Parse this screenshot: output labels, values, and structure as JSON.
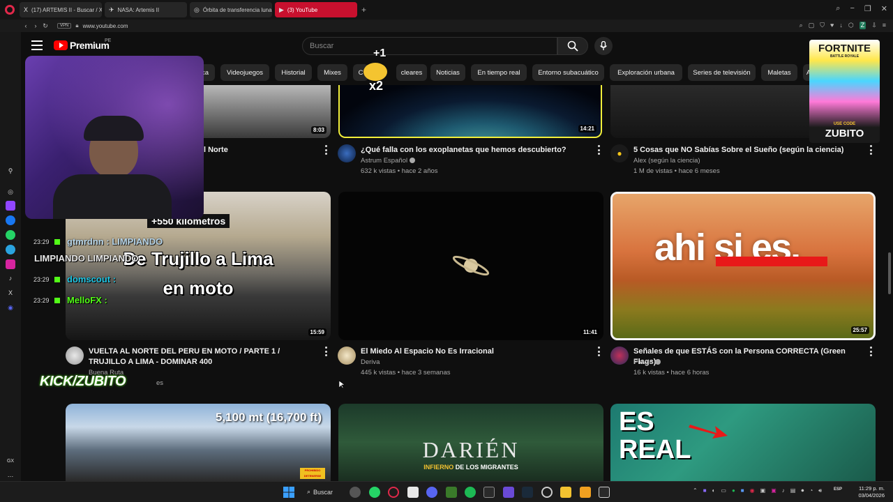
{
  "browser": {
    "tabs": [
      {
        "icon": "X",
        "label": "(17) ARTEMIS II - Buscar / X"
      },
      {
        "icon": "✈",
        "label": "NASA: Artemis II"
      },
      {
        "icon": "◎",
        "label": "Órbita de transferencia lunar"
      },
      {
        "icon": "▶",
        "label": "(3) YouTube"
      }
    ],
    "vpn_label": "VPN",
    "url": "www.youtube.com"
  },
  "youtube": {
    "brand": "Premium",
    "country": "PE",
    "search_placeholder": "Buscar",
    "chips": [
      "ca",
      "Videojuegos",
      "Historial",
      "Mixes",
      "C",
      "cleares",
      "Noticias",
      "En tiempo real",
      "Entorno subacuático",
      "Exploración urbana",
      "Series de televisión",
      "Maletas",
      "A"
    ]
  },
  "videos_row1": [
    {
      "duration": "8:03",
      "title_fragment": "l Norte"
    },
    {
      "duration": "14:21",
      "title": "¿Qué falla con los exoplanetas que hemos descubierto?",
      "channel": "Astrum Español",
      "meta": "632 k vistas • hace 2 años"
    },
    {
      "title": "5 Cosas que NO Sabías Sobre el Sueño (según la ciencia)",
      "channel": "Alex (según la ciencia)",
      "meta": "1 M de vistas • hace 6 meses"
    }
  ],
  "videos_row2": [
    {
      "duration": "15:59",
      "thumb_text_top": "+550 kilometros",
      "thumb_text_main": "De Trujillo a Lima en moto",
      "title": "VUELTA AL NORTE DEL PERU EN MOTO / PARTE 1 / TRUJILLO A LIMA - DOMINAR 400",
      "channel": "Buena Ruta",
      "meta_fragment": "es"
    },
    {
      "duration": "11:41",
      "title": "El Miedo Al Espacio No Es Irracional",
      "channel": "Deriva",
      "meta": "445 k vistas • hace 3 semanas"
    },
    {
      "duration": "25:57",
      "thumb_text": "ahi si es.",
      "title": "Señales de que ESTÁS con la Persona CORRECTA (Green Flags)",
      "channel": "Pinwin",
      "meta": "16 k vistas • hace 6 horas"
    }
  ],
  "videos_row3": [
    {
      "thumb_text": "5,100 mt (16,700 ft)",
      "badge_text": "PROHIBIDO DETENERSE"
    },
    {
      "thumb_title": "DARIÉN",
      "thumb_sub_a": "INFIERNO",
      "thumb_sub_b": " DE LOS MIGRANTES"
    },
    {
      "thumb_text": "ES REAL"
    }
  ],
  "stream_overlay": {
    "chat": [
      {
        "time": "23:29",
        "text": "gtmrdnn : LIMPIANDO"
      },
      {
        "time": "",
        "text": "LIMPIANDO   LIMPIANDO"
      },
      {
        "time": "23:29",
        "text": "domscout :"
      },
      {
        "time": "23:29",
        "text": "MelloFX :"
      }
    ],
    "kick_label": "KICK/ZUBITO",
    "emote_text_a": "+1",
    "emote_text_b": "x2",
    "ad_title": "FORTNITE",
    "ad_sub": "BATTLE ROYALE",
    "ad_code_label": "USE CODE",
    "ad_code": "ZUBITO"
  },
  "taskbar": {
    "search_label": "Buscar",
    "time": "11:29 p. m.",
    "date": "03/04/2026",
    "lang": "ESP"
  },
  "sidebar_label": "GX"
}
